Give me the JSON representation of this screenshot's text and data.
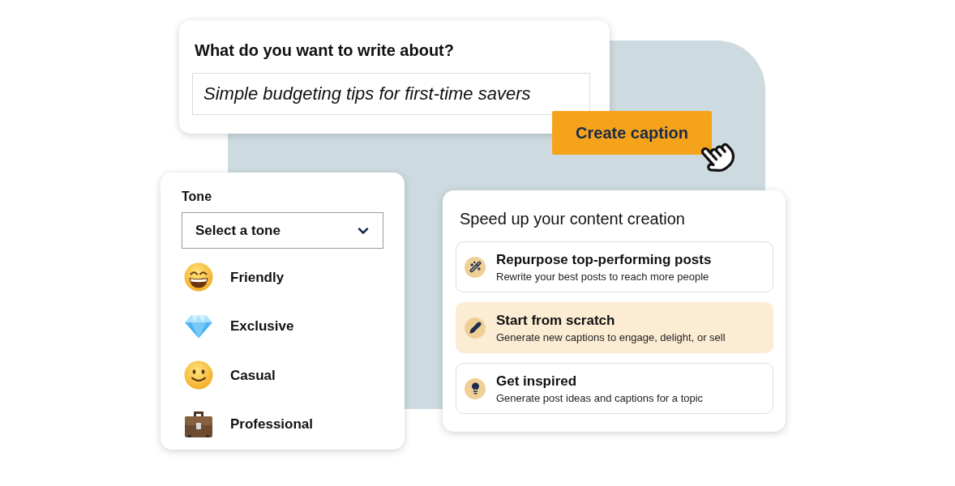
{
  "prompt_card": {
    "title": "What do you want to write about?",
    "input": {
      "value": "Simple budgeting tips for first-time savers"
    }
  },
  "create_button": {
    "label": "Create caption"
  },
  "tone_card": {
    "label": "Tone",
    "select": {
      "placeholder": "Select a tone"
    },
    "options": [
      {
        "label": "Friendly"
      },
      {
        "label": "Exclusive"
      },
      {
        "label": "Casual"
      },
      {
        "label": "Professional"
      }
    ]
  },
  "options_card": {
    "title": "Speed up your content creation",
    "options": [
      {
        "title": "Repurpose top-performing posts",
        "description": "Rewrite your best posts to reach more people",
        "selected": false
      },
      {
        "title": "Start from scratch",
        "description": "Generate new captions to engage, delight, or sell",
        "selected": true
      },
      {
        "title": "Get inspired",
        "description": "Generate post ideas and captions for a topic",
        "selected": false
      }
    ]
  }
}
